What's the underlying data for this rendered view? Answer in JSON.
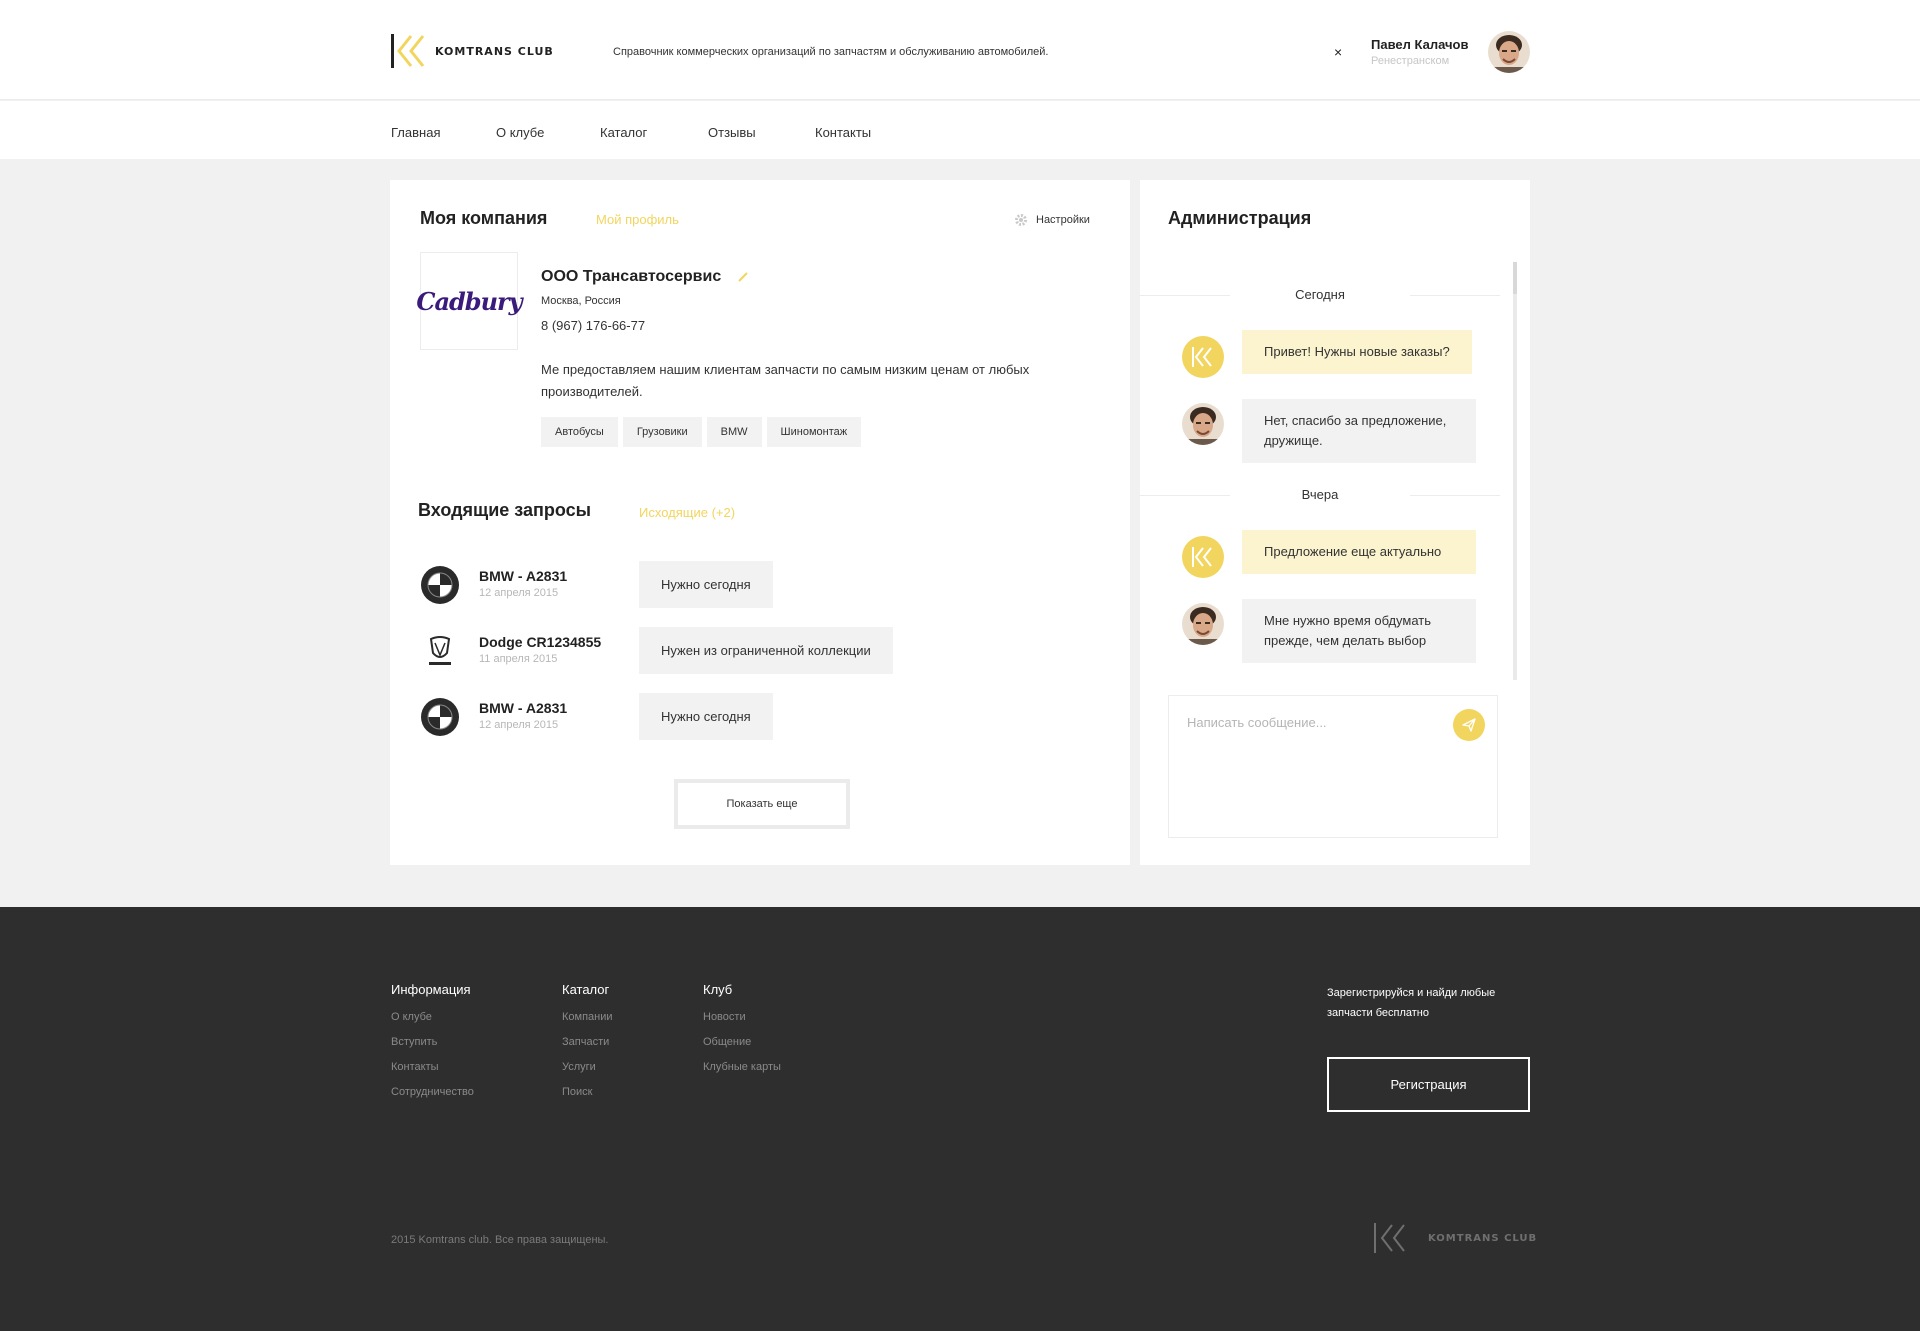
{
  "header": {
    "logo_text": "KOMTRANS CLUB",
    "tagline": "Справочник коммерческих организаций по запчастям и обслуживанию автомобилей.",
    "close_label": "×",
    "user_name": "Павел Калачов",
    "user_sub": "Ренестранском"
  },
  "nav": {
    "items": [
      "Главная",
      "О клубе",
      "Каталог",
      "Отзывы",
      "Контакты"
    ]
  },
  "company": {
    "heading": "Моя компания",
    "profile_link": "Мой профиль",
    "settings_label": "Настройки",
    "logo_text": "Cadbury",
    "name": "ООО Трансавтосервис",
    "city": "Москва, Россия",
    "phone": "8 (967) 176-66-77",
    "description": "Ме предоставляем нашим клиентам запчасти по самым низким ценам от любых производителей.",
    "tags": [
      "Автобусы",
      "Грузовики",
      "BMW",
      "Шиномонтаж"
    ]
  },
  "requests": {
    "heading": "Входящие запросы",
    "outgoing_link": "Исходящие (+2)",
    "items": [
      {
        "brand": "bmw",
        "title": "BMW - A2831",
        "date": "12 апреля 2015",
        "button": "Нужно сегодня"
      },
      {
        "brand": "dodge",
        "title": "Dodge CR1234855",
        "date": "11 апреля 2015",
        "button": "Нужен из ограниченной коллекции"
      },
      {
        "brand": "bmw",
        "title": "BMW - A2831",
        "date": "12 апреля 2015",
        "button": "Нужно сегодня"
      }
    ],
    "show_more": "Показать еще"
  },
  "chat": {
    "heading": "Администрация",
    "days": [
      "Сегодня",
      "Вчера"
    ],
    "messages": [
      {
        "from": "admin",
        "text": "Привет! Нужны новые заказы?"
      },
      {
        "from": "user",
        "text": "Нет, спасибо за предложение, дружище."
      },
      {
        "from": "admin",
        "text": "Предложение  еще актуально"
      },
      {
        "from": "user",
        "text": "Мне нужно время обдумать прежде, чем делать выбор"
      }
    ],
    "placeholder": "Написать сообщение..."
  },
  "footer": {
    "columns": [
      {
        "heading": "Информация",
        "links": [
          "О клубе",
          "Вступить",
          "Контакты",
          "Сотрудничество"
        ]
      },
      {
        "heading": "Каталог",
        "links": [
          "Компании",
          "Запчасти",
          "Услуги",
          "Поиск"
        ]
      },
      {
        "heading": "Клуб",
        "links": [
          "Новости",
          "Общение",
          "Клубные карты"
        ]
      }
    ],
    "cta": "Зарегистрируйся и найди любые запчасти бесплатно",
    "register": "Регистрация",
    "copyright": "2015 Komtrans club. Все права защищены.",
    "logo_text": "KOMTRANS CLUB"
  },
  "colors": {
    "accent": "#f2d55e",
    "footer_bg": "#2e2e2e",
    "page_bg": "#f1f1f1",
    "admin_bubble": "#fcf4cf"
  }
}
